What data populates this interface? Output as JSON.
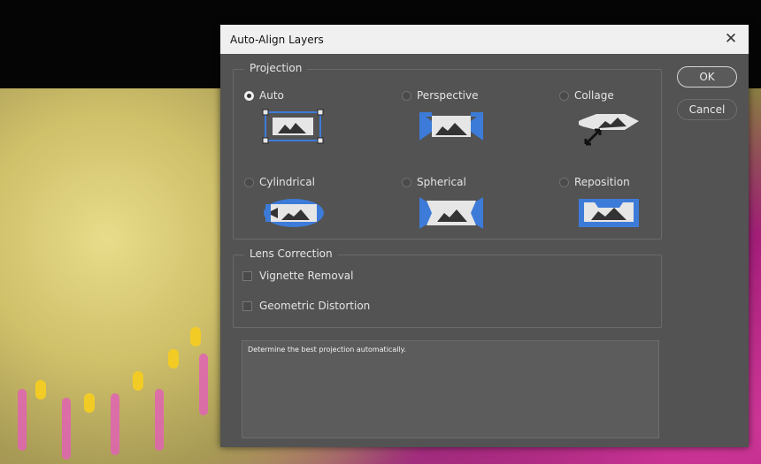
{
  "dialog": {
    "title": "Auto-Align Layers",
    "close_glyph": "✕"
  },
  "projection": {
    "title": "Projection",
    "options": [
      {
        "label": "Auto",
        "checked": true,
        "icon": "auto-projection-icon"
      },
      {
        "label": "Perspective",
        "checked": false,
        "icon": "perspective-projection-icon"
      },
      {
        "label": "Collage",
        "checked": false,
        "icon": "collage-projection-icon"
      },
      {
        "label": "Cylindrical",
        "checked": false,
        "icon": "cylindrical-projection-icon"
      },
      {
        "label": "Spherical",
        "checked": false,
        "icon": "spherical-projection-icon"
      },
      {
        "label": "Reposition",
        "checked": false,
        "icon": "reposition-projection-icon"
      }
    ]
  },
  "lens": {
    "title": "Lens Correction",
    "vignette_label": "Vignette Removal",
    "geometric_label": "Geometric Distortion"
  },
  "description": "Determine the best projection automatically.",
  "buttons": {
    "ok": "OK",
    "cancel": "Cancel"
  },
  "colors": {
    "dialog_bg": "#535353",
    "accent_blue": "#3d7bd9",
    "titlebar_bg": "#f0f0f0"
  }
}
